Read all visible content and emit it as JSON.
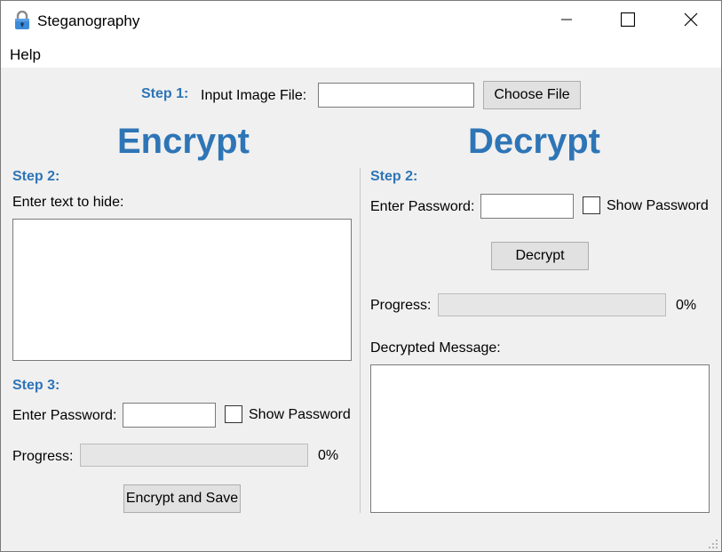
{
  "window": {
    "title": "Steganography",
    "icon": "lock-icon"
  },
  "menu": {
    "help": "Help"
  },
  "step1": {
    "label": "Step 1:",
    "input_label": "Input Image File:",
    "input_value": "",
    "choose_button": "Choose File"
  },
  "encrypt": {
    "title": "Encrypt",
    "step2_label": "Step 2:",
    "text_label": "Enter text to hide:",
    "text_value": "",
    "step3_label": "Step 3:",
    "password_label": "Enter Password:",
    "password_value": "",
    "show_password_label": "Show Password",
    "show_password_checked": false,
    "progress_label": "Progress:",
    "progress_value": 0,
    "progress_text": "0%",
    "button": "Encrypt and Save"
  },
  "decrypt": {
    "title": "Decrypt",
    "step2_label": "Step 2:",
    "password_label": "Enter Password:",
    "password_value": "",
    "show_password_label": "Show Password",
    "show_password_checked": false,
    "button": "Decrypt",
    "progress_label": "Progress:",
    "progress_value": 0,
    "progress_text": "0%",
    "message_label": "Decrypted Message:",
    "message_value": ""
  },
  "colors": {
    "accent": "#2e75b6",
    "window_bg": "#f0f0f0",
    "progress_fill": "#06b025"
  }
}
